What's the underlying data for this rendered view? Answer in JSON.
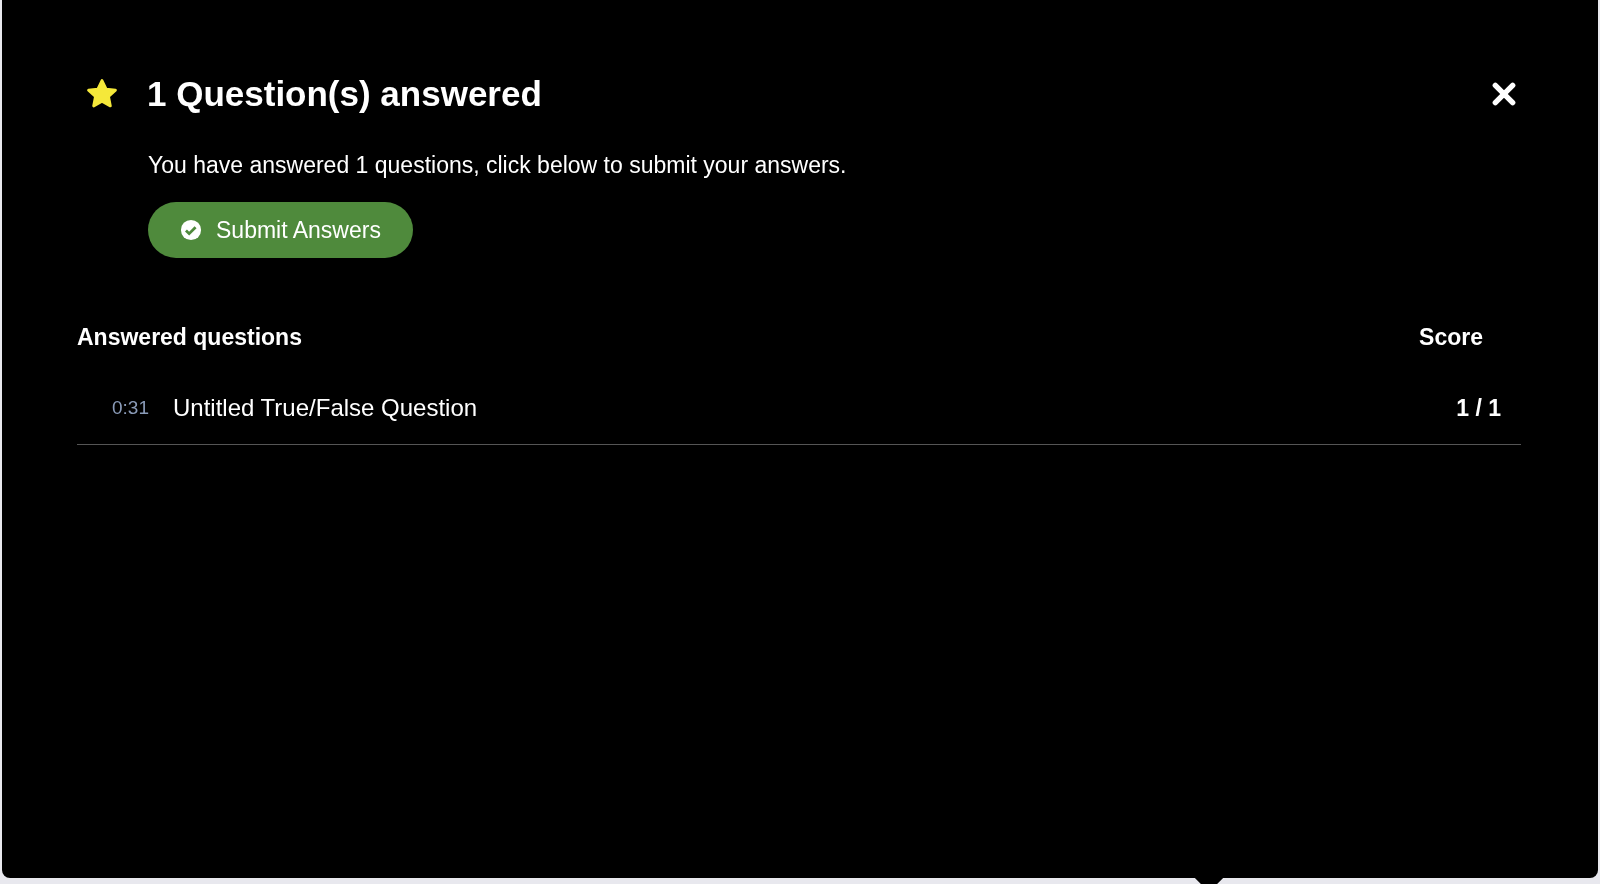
{
  "dialog": {
    "title": "1 Question(s) answered",
    "message": "You have answered 1 questions, click below to submit your answers.",
    "submit_button": "Submit Answers"
  },
  "table": {
    "columns": [
      "Answered questions",
      "Score"
    ],
    "rows": [
      {
        "time": "0:31",
        "question": "Untitled True/False Question",
        "score": "1 / 1"
      }
    ]
  }
}
